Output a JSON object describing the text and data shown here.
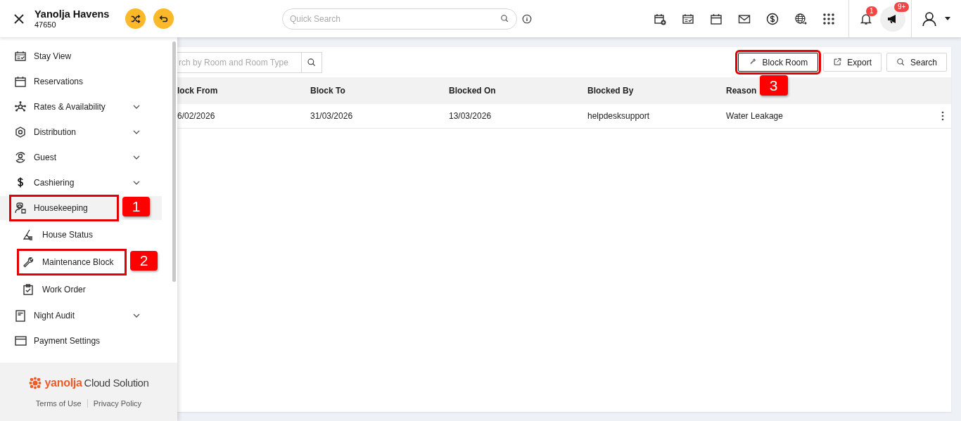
{
  "header": {
    "property_name": "Yanolja Havens",
    "property_code": "47650",
    "search": {
      "placeholder": "Quick Search"
    },
    "notifications": {
      "badge": "1"
    },
    "announcements": {
      "badge": "9+"
    }
  },
  "sidebar": {
    "items": [
      {
        "label": "Stay View",
        "kind": "stay-view",
        "chevron": false,
        "selected": false
      },
      {
        "label": "Reservations",
        "kind": "reservations",
        "chevron": false,
        "selected": false
      },
      {
        "label": "Rates & Availability",
        "kind": "rates",
        "chevron": true,
        "selected": false
      },
      {
        "label": "Distribution",
        "kind": "distribution",
        "chevron": true,
        "selected": false
      },
      {
        "label": "Guest",
        "kind": "guest",
        "chevron": true,
        "selected": false
      },
      {
        "label": "Cashiering",
        "kind": "cashiering",
        "chevron": true,
        "selected": false
      },
      {
        "label": "Housekeeping",
        "kind": "housekeeping",
        "chevron": false,
        "selected": true,
        "callout": "1",
        "children": [
          {
            "label": "House Status",
            "kind": "house-status",
            "selected": false
          },
          {
            "label": "Maintenance Block",
            "kind": "maintenance",
            "selected": false,
            "callout": "2"
          },
          {
            "label": "Work Order",
            "kind": "work-order",
            "selected": false
          }
        ]
      },
      {
        "label": "Night Audit",
        "kind": "night-audit",
        "chevron": true,
        "selected": false
      },
      {
        "label": "Payment Settings",
        "kind": "payment",
        "chevron": false,
        "selected": false
      }
    ],
    "footer": {
      "logo_brand": "yanolja",
      "logo_product": "Cloud Solution",
      "links": [
        "Terms of Use",
        "Privacy Policy"
      ]
    }
  },
  "toolbar": {
    "search": {
      "placeholder": "rch by Room and Room Type"
    },
    "buttons": [
      {
        "label": "Block Room",
        "kind": "block",
        "callout": "3"
      },
      {
        "label": "Export",
        "kind": "export"
      },
      {
        "label": "Search",
        "kind": "search"
      }
    ]
  },
  "table": {
    "columns": [
      "lock From",
      "Block To",
      "Blocked On",
      "Blocked By",
      "Reason"
    ],
    "rows": [
      {
        "cells": [
          "6/02/2026",
          "31/03/2026",
          "13/03/2026",
          "helpdesksupport",
          "Water Leakage"
        ]
      }
    ]
  }
}
